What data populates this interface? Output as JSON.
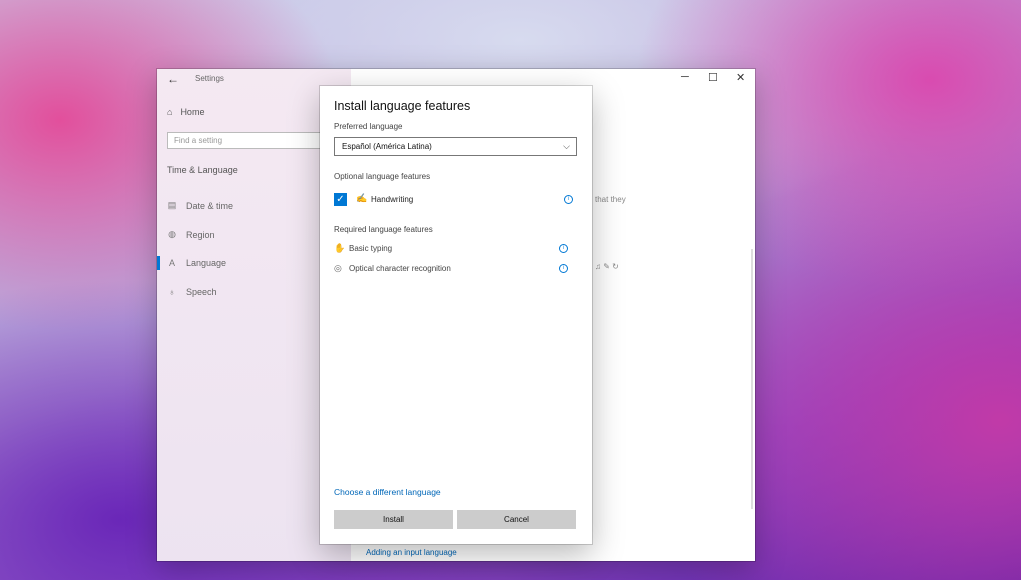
{
  "window": {
    "title": "Settings",
    "back_icon": "←",
    "minimize_icon": "─",
    "maximize_icon": "☐",
    "close_icon": "✕"
  },
  "sidebar": {
    "home_icon": "⌂",
    "home_label": "Home",
    "search_placeholder": "Find a setting",
    "section_label": "Time & Language",
    "items": [
      {
        "icon": "▤",
        "label": "Date & time"
      },
      {
        "icon": "◍",
        "label": "Region"
      },
      {
        "icon": "A",
        "label": "Language"
      },
      {
        "icon": "♁",
        "label": "Speech"
      }
    ]
  },
  "background": {
    "partial_text": "that they",
    "partial_icons": "♫ ✎ ↻",
    "link": "Adding an input language"
  },
  "dialog": {
    "title": "Install language features",
    "preferred_label": "Preferred language",
    "preferred_value": "Español (América Latina)",
    "chevron_icon": "⌵",
    "optional_label": "Optional language features",
    "checkbox_icon": "✓",
    "handwriting_icon": "✍",
    "handwriting_label": "Handwriting",
    "info_icon": "i",
    "required_label": "Required language features",
    "required_items": [
      {
        "icon": "✋",
        "label": "Basic typing"
      },
      {
        "icon": "◎",
        "label": "Optical character recognition"
      }
    ],
    "choose_link": "Choose a different language",
    "install_label": "Install",
    "cancel_label": "Cancel"
  },
  "colors": {
    "accent": "#0078d4",
    "link": "#0067b8",
    "button": "#cccccc"
  }
}
